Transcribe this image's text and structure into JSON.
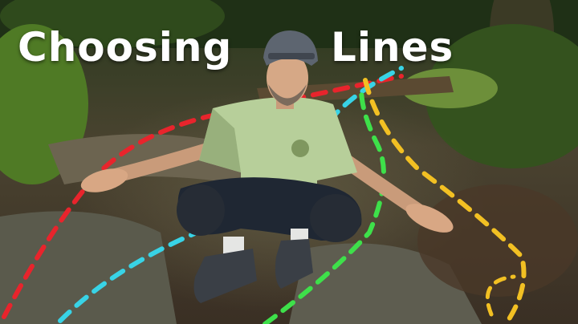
{
  "title": {
    "word1": "Choosing",
    "word2": "Lines"
  },
  "colors": {
    "line_red": "#e8242c",
    "line_cyan": "#38d3e6",
    "line_green": "#3ee04a",
    "line_yellow": "#f2c023",
    "forest_dark": "#2c3320",
    "moss": "#5f8a2e",
    "jersey": "#b7cf9a",
    "shorts": "#1f2733"
  },
  "icons": [
    "helmet-icon",
    "jersey-logo-icon"
  ]
}
